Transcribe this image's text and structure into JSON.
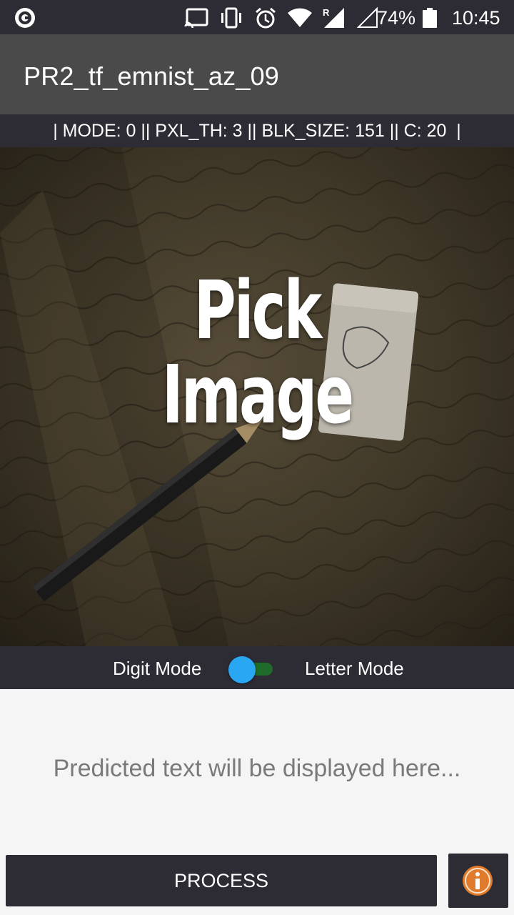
{
  "status_bar": {
    "battery_text": "74%",
    "time": "10:45",
    "icons": [
      "app-notification-icon",
      "cast-icon",
      "vibrate-icon",
      "alarm-icon",
      "wifi-icon",
      "signal-roaming-icon",
      "signal-empty-icon",
      "battery-icon"
    ],
    "roaming_letter": "R"
  },
  "app_bar": {
    "title": "PR2_tf_emnist_az_09"
  },
  "params": {
    "text": "| MODE: 0 || PXL_TH: 3 || BLK_SIZE: 151 || C: 20  |"
  },
  "image_area": {
    "label": "Pick\nImage"
  },
  "mode": {
    "digit_label": "Digit Mode",
    "letter_label": "Letter Mode",
    "switch_on": false
  },
  "prediction": {
    "placeholder": "Predicted text will be displayed here..."
  },
  "actions": {
    "process_label": "PROCESS",
    "info_icon": "info-icon"
  },
  "colors": {
    "bar_dark": "#2d2b33",
    "app_bar": "#4a4a4a",
    "switch_thumb": "#2aa7f2",
    "switch_track": "#1e6b2a",
    "info_orange": "#e07a2c"
  }
}
